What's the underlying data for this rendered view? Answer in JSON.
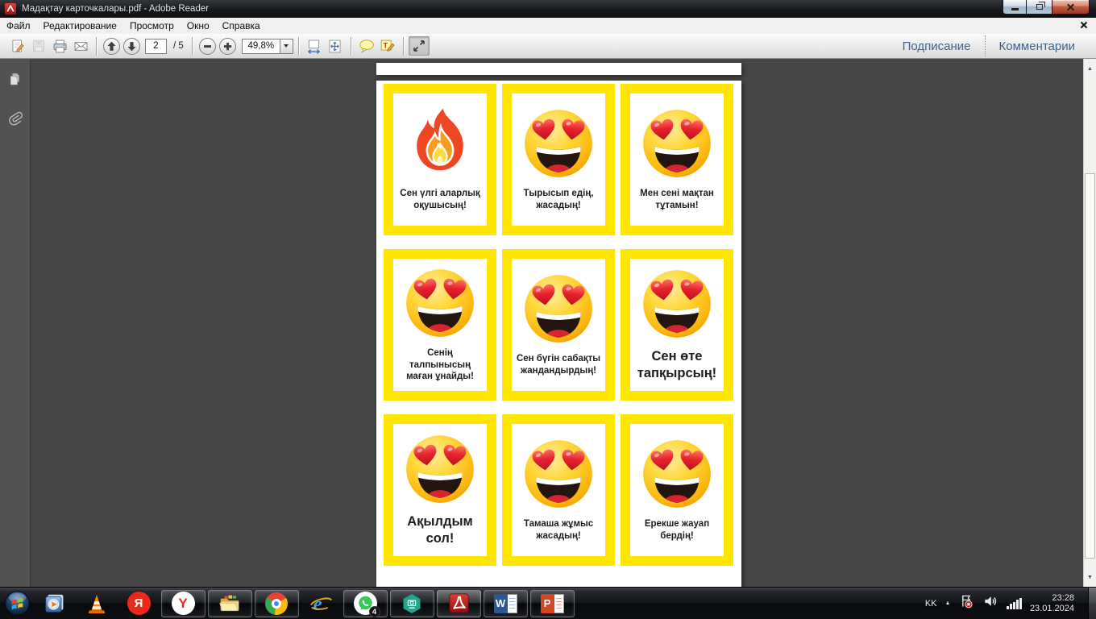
{
  "window": {
    "title": "Мадақтау карточкалары.pdf - Adobe Reader"
  },
  "menubar": {
    "items": [
      "Файл",
      "Редактирование",
      "Просмотр",
      "Окно",
      "Справка"
    ]
  },
  "toolbar": {
    "page_current": "2",
    "page_total_label": "/ 5",
    "zoom_value": "49,8%",
    "signing_label": "Подписание",
    "comments_label": "Комментарии"
  },
  "document": {
    "cards": [
      {
        "icon": "fire-emoji",
        "text": "Сен үлгі аларлық оқушысың!",
        "size": "normal"
      },
      {
        "icon": "heart-eyes-emoji",
        "text": "Тырысып едің, жасадың!",
        "size": "normal"
      },
      {
        "icon": "heart-eyes-emoji",
        "text": "Мен сені мақтан тұтамын!",
        "size": "normal"
      },
      {
        "icon": "heart-eyes-emoji",
        "text": "Сенің талпынысың маған ұнайды!",
        "size": "normal"
      },
      {
        "icon": "heart-eyes-emoji",
        "text": "Сен бүгін сабақты жандандырдың!",
        "size": "normal"
      },
      {
        "icon": "heart-eyes-emoji",
        "text": "Сен өте тапқырсың!",
        "size": "large"
      },
      {
        "icon": "heart-eyes-emoji",
        "text": "Ақылдым сол!",
        "size": "large"
      },
      {
        "icon": "heart-eyes-emoji",
        "text": "Тамаша жұмыс жасадың!",
        "size": "normal"
      },
      {
        "icon": "heart-eyes-emoji",
        "text": "Ерекше жауап бердің!",
        "size": "normal"
      }
    ]
  },
  "taskbar": {
    "items": [
      {
        "name": "windows-media-player",
        "running": false
      },
      {
        "name": "vlc",
        "running": false
      },
      {
        "name": "yandex-search",
        "running": false
      },
      {
        "name": "yandex-browser",
        "running": true
      },
      {
        "name": "file-explorer",
        "running": true
      },
      {
        "name": "chrome",
        "running": true
      },
      {
        "name": "internet-explorer",
        "running": false
      },
      {
        "name": "whatsapp",
        "running": true,
        "badge": "4"
      },
      {
        "name": "security-app",
        "running": true
      },
      {
        "name": "adobe-reader",
        "running": true,
        "active": true
      },
      {
        "name": "word",
        "running": true
      },
      {
        "name": "powerpoint",
        "running": true
      }
    ],
    "tray": {
      "language": "KK",
      "time": "23:28",
      "date": "23.01.2024"
    }
  },
  "icons": {
    "yandex_search_letter": "Я",
    "yandex_browser_letter": "Y",
    "internet_explorer_letter": "e",
    "word_letter": "W",
    "powerpoint_letter": "P",
    "scroll_up_glyph": "▲",
    "scroll_down_glyph": "▼",
    "tray_expand_glyph": "▲"
  },
  "colors": {
    "card_yellow": "#FFE600",
    "toolbar_label_blue": "#3A638F",
    "taskbar_dark": "#0D0F13",
    "emoji_heart_red": "#E8222D",
    "fire_orange": "#EE4623"
  }
}
